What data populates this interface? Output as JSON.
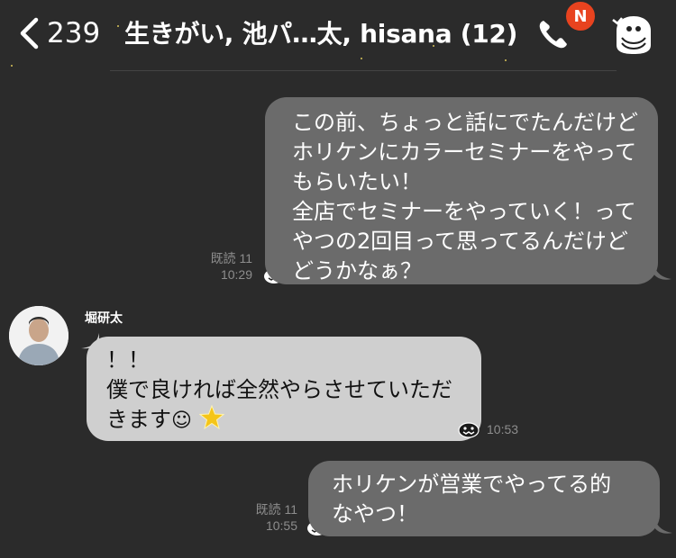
{
  "header": {
    "back_count": "239",
    "title": "生きがい, 池パ…太, hisana (12)",
    "notification_badge": "N",
    "badge_color": "#e8431f"
  },
  "messages": [
    {
      "direction": "outgoing",
      "lines": [
        "この前、ちょっと話にでたんだけど",
        "ホリケンにカラーセミナーをやって",
        "もらいたい！",
        "全店でセミナーをやっていく！って",
        "やつの2回目って思ってるんだけど",
        "どうかなぁ？"
      ],
      "read_label": "既読 11",
      "time": "10:29"
    },
    {
      "direction": "incoming",
      "sender": "堀研太",
      "lines": [
        "！！",
        "僕で良ければ全然やらさせていただ",
        "きます"
      ],
      "emoji": [
        "☺",
        "star-icon"
      ],
      "time": "10:53"
    },
    {
      "direction": "outgoing",
      "lines": [
        "ホリケンが営業でやってる的",
        "なやつ！"
      ],
      "read_label": "既読 11",
      "time": "10:55"
    }
  ],
  "colors": {
    "background": "#2b2b2b",
    "outgoing_bubble": "#6b6b6b",
    "incoming_bubble": "#cfcfcf"
  }
}
